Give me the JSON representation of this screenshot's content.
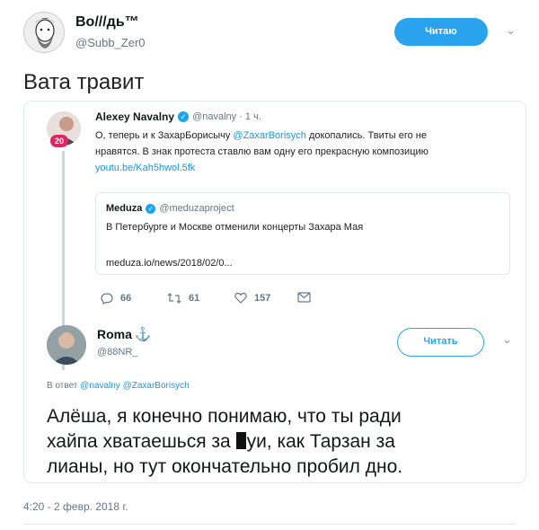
{
  "main_tweet": {
    "display_name": "Во///дь™",
    "handle": "@Subb_Zer0",
    "follow_label": "Читаю",
    "text": "Вата травит"
  },
  "quoted_tweet": {
    "display_name": "Alexey Navalny",
    "handle_time": "@navalny · 1 ч.",
    "badge": "20",
    "text_line1_a": "О, теперь и к ЗахарБорисычу ",
    "text_line1_mention": "@ZaxarBorisych",
    "text_line1_b": " докопались. Твиты его не",
    "text_line2": "нравятся. В знак протеста ставлю вам одну его прекрасную композицию",
    "text_link": "youtu.be/Kah5hwol.5fk",
    "inner_card": {
      "display_name": "Meduza",
      "handle": "@meduzaproject",
      "text": "В Петербурге и Москве отменили концерты Захара Мая",
      "link": "meduza.io/news/2018/02/0..."
    },
    "actions": {
      "replies": "66",
      "retweets": "61",
      "likes": "157"
    }
  },
  "reply_tweet": {
    "display_name": "Roma",
    "anchor_glyph": "⚓",
    "handle": "@88NR_",
    "follow_label": "Читать",
    "reply_to_prefix": "В ответ ",
    "reply_to_mentions": "@navalny @ZaxarBorisych",
    "text_line1": "Алёша, я конечно понимаю, что ты ради",
    "text_line2_a": "хайпа хватаешься за ",
    "text_line2_b": "уи, как Тарзан за",
    "text_line3": "лианы, но тут окончательно пробил дно."
  },
  "timestamp": "4:20 - 2 февр. 2018 г.",
  "colors": {
    "accent": "#2aa3ef",
    "link": "#1b95e0",
    "muted": "#657786"
  }
}
